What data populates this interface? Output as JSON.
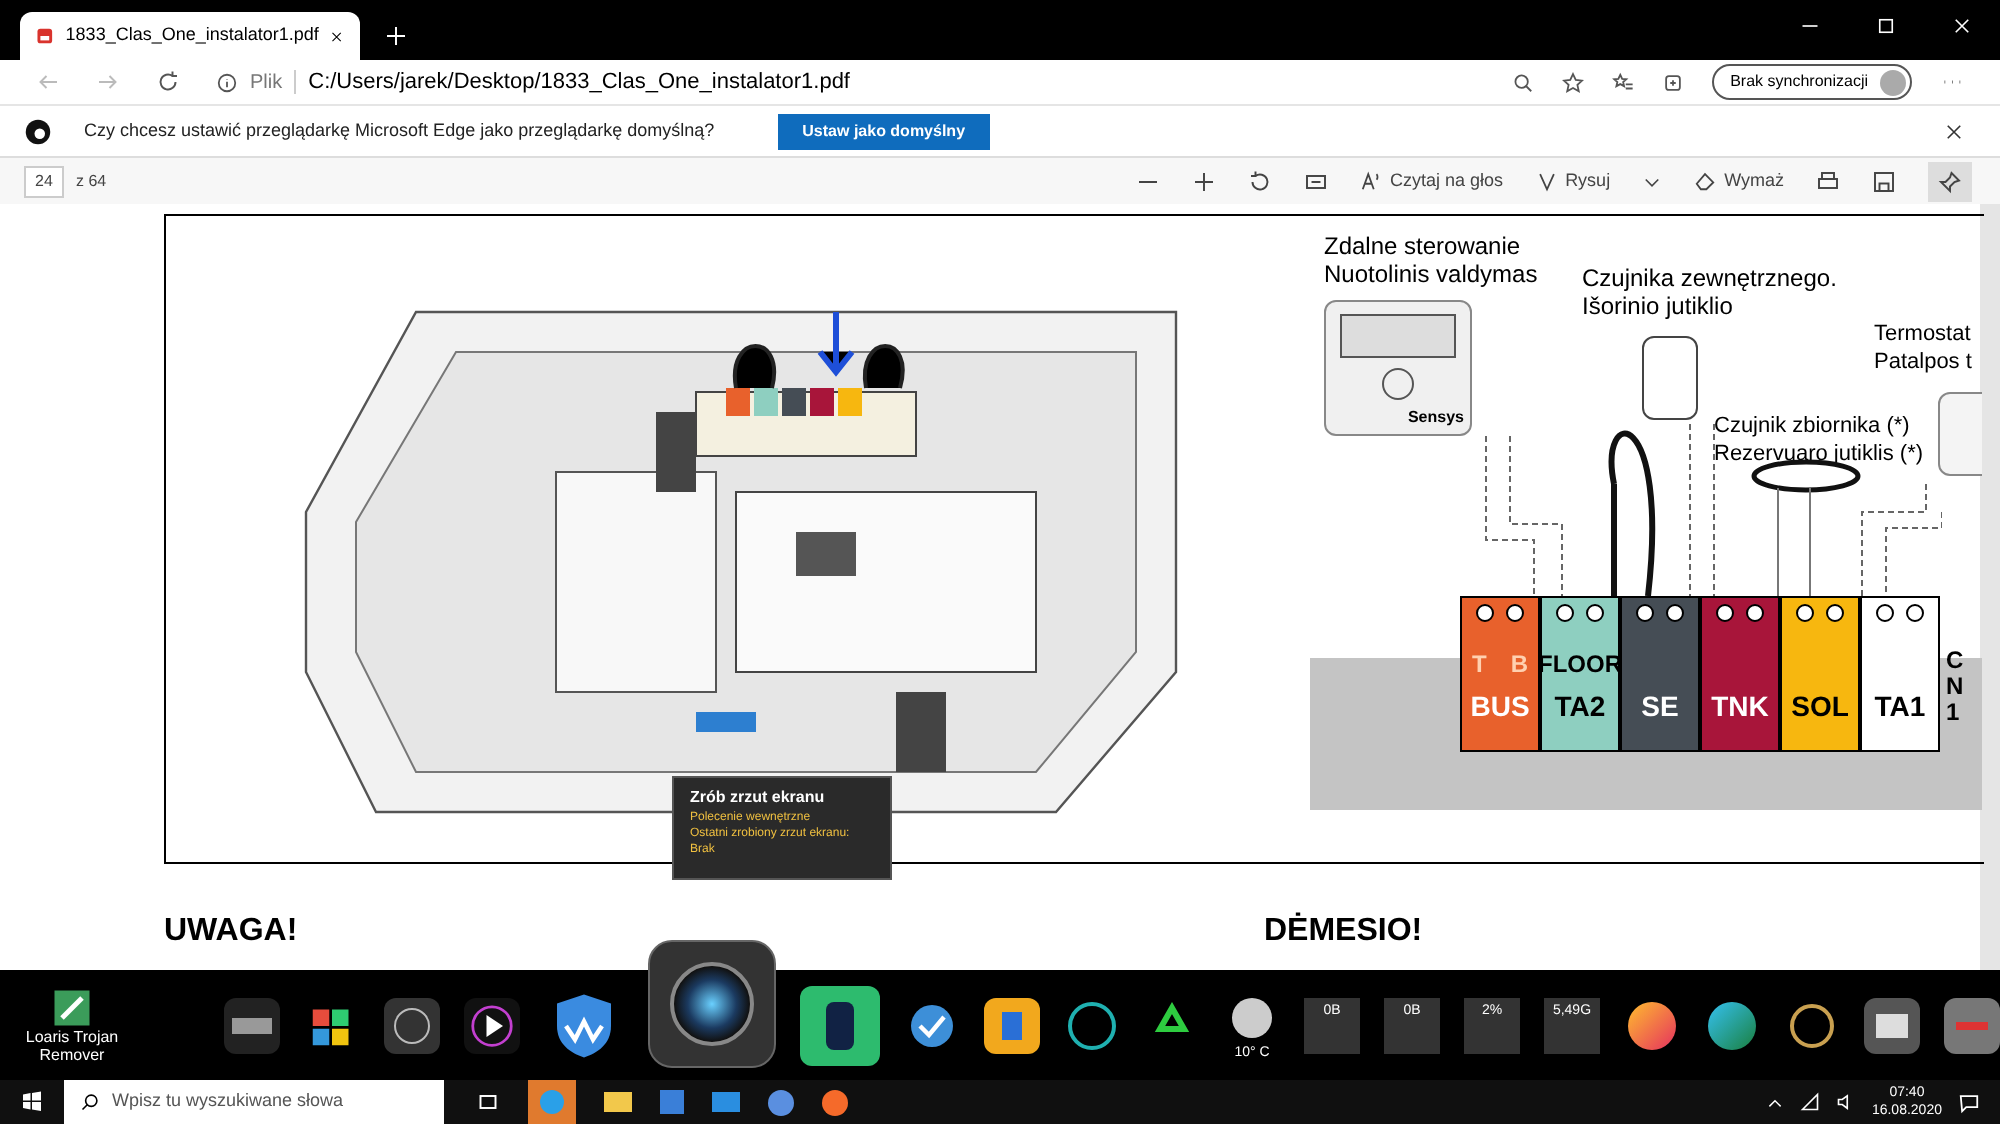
{
  "browser": {
    "tab_title": "1833_Clas_One_instalator1.pdf",
    "address_prefix": "Plik",
    "url": "C:/Users/jarek/Desktop/1833_Clas_One_instalator1.pdf",
    "sync_button": "Brak synchronizacji"
  },
  "infobar": {
    "message": "Czy chcesz ustawić przeglądarkę Microsoft Edge jako przeglądarkę domyślną?",
    "button": "Ustaw jako domyślny"
  },
  "pdf_toolbar": {
    "page": "24",
    "total": "z 64",
    "read_aloud": "Czytaj na głos",
    "draw": "Rysuj",
    "erase": "Wymaż"
  },
  "diagram": {
    "remote_label": [
      "Zdalne sterowanie",
      "Nuotolinis valdymas"
    ],
    "remote_brand": "Sensys",
    "outdoor_label": [
      "Czujnika zewnętrznego.",
      "Išorinio jutiklio"
    ],
    "tank_label": [
      "Czujnik zbiornika (*)",
      "Rezervuaro jutiklis (*)"
    ],
    "thermostat_label": [
      "Termostat",
      "Patalpos t"
    ],
    "terminals": [
      {
        "top": [
          "T",
          "B"
        ],
        "label": "BUS",
        "color": "#e8612c"
      },
      {
        "top": [
          "FLOOR"
        ],
        "label": "TA2",
        "color": "#8ecfc0"
      },
      {
        "label": "SE",
        "color": "#454d55"
      },
      {
        "label": "TNK",
        "color": "#a8153a"
      },
      {
        "label": "SOL",
        "color": "#f7b70f"
      },
      {
        "label": "TA1",
        "color": "#ffffff"
      }
    ],
    "connector": "CN1"
  },
  "headings": [
    "UWAGA!",
    "DĖMESIO!"
  ],
  "tooltip": {
    "title": "Zrób zrzut ekranu",
    "lines": [
      "Polecenie wewnętrzne",
      "Ostatni zrobiony zrzut ekranu:",
      "Brak"
    ]
  },
  "desktop_icon": "Loaris Trojan Remover",
  "dock": {
    "weather": "10° C",
    "meters": [
      "0B",
      "0B",
      "2%",
      "5,49G"
    ]
  },
  "taskbar": {
    "search_placeholder": "Wpisz tu wyszukiwane słowa",
    "time": "07:40",
    "date": "16.08.2020"
  }
}
